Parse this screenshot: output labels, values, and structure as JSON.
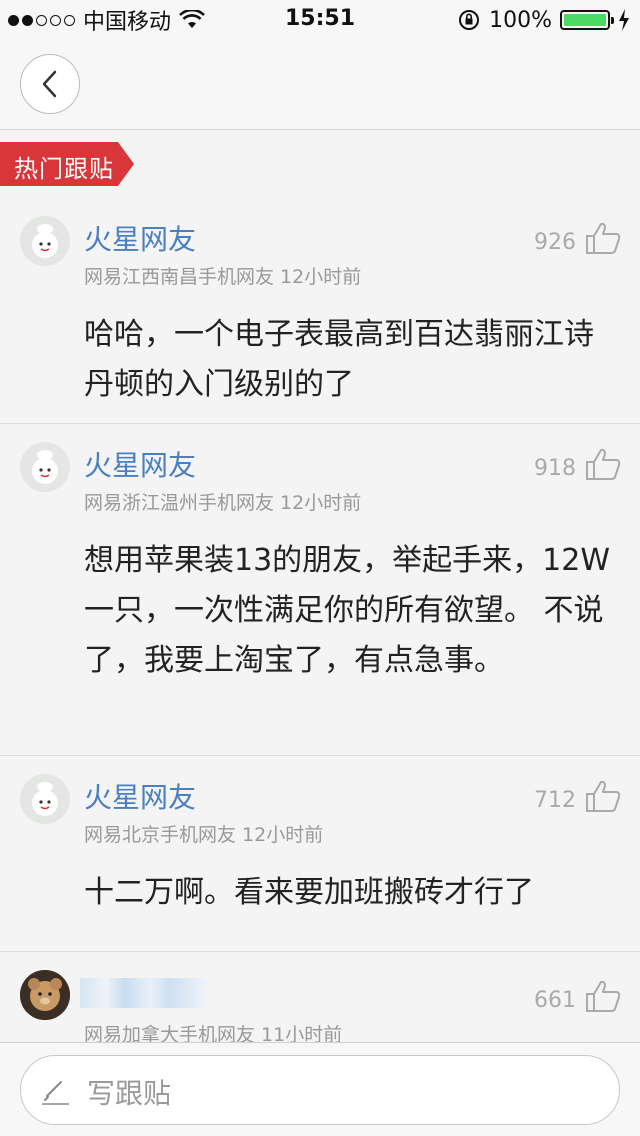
{
  "status_bar": {
    "carrier": "中国移动",
    "time": "15:51",
    "battery": "100%",
    "battery_level": 1.0,
    "signal_bars_filled": 2,
    "signal_bars_total": 5
  },
  "nav": {},
  "section": {
    "hot_label": "热门跟贴",
    "accent": "#d9363a"
  },
  "comments": [
    {
      "username": "火星网友",
      "meta": "网易江西南昌手机网友 12小时前",
      "votes": "926",
      "body": "哈哈，一个电子表最高到百达翡丽江诗丹顿的入门级别的了"
    },
    {
      "username": "火星网友",
      "meta": "网易浙江温州手机网友 12小时前",
      "votes": "918",
      "body": "想用苹果装13的朋友，举起手来，12W一只，一次性满足你的所有欲望。 不说了，我要上淘宝了，有点急事。"
    },
    {
      "username": "火星网友",
      "meta": "网易北京手机网友 12小时前",
      "votes": "712",
      "body": "十二万啊。看来要加班搬砖才行了"
    },
    {
      "username": "",
      "meta": "网易加拿大手机网友 11小时前",
      "votes": "661",
      "body": ""
    }
  ],
  "compose": {
    "placeholder": "写跟贴"
  },
  "colors": {
    "link": "#4a7fc0",
    "battery": "#4cd964",
    "muted": "#999999"
  }
}
